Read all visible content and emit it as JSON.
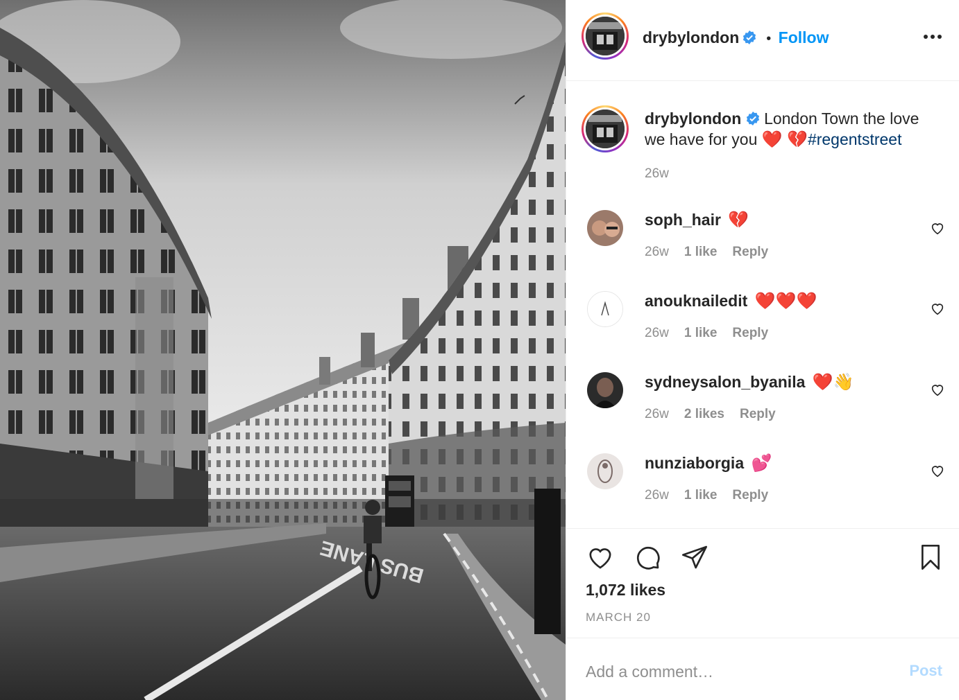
{
  "post": {
    "username": "drybylondon",
    "follow_label": "Follow",
    "separator": "•",
    "photo_subject": "black-and-white street photo of curved Regent Street buildings with a cyclist",
    "road_marking": "BUS LANE"
  },
  "caption": {
    "username": "drybylondon",
    "text_before": "London Town the love we have for you",
    "emoji_1": "❤️",
    "emoji_2": "💔",
    "hashtag": "#regentstreet",
    "time": "26w"
  },
  "comments": [
    {
      "username": "soph_hair",
      "text": "💔",
      "time": "26w",
      "likes": "1 like",
      "reply": "Reply"
    },
    {
      "username": "anouknailedit",
      "text": "❤️❤️❤️",
      "time": "26w",
      "likes": "1 like",
      "reply": "Reply"
    },
    {
      "username": "sydneysalon_byanila",
      "text": "❤️👋",
      "time": "26w",
      "likes": "2 likes",
      "reply": "Reply"
    },
    {
      "username": "nunziaborgia",
      "text": "💕",
      "time": "26w",
      "likes": "1 like",
      "reply": "Reply"
    }
  ],
  "actions": {
    "likes": "1,072 likes",
    "date": "MARCH 20"
  },
  "comment_box": {
    "placeholder": "Add a comment…",
    "post_label": "Post"
  },
  "colors": {
    "accent": "#0095f6",
    "hashtag": "#00376b",
    "muted": "#8e8e8e",
    "post_disabled": "#b3dbff"
  }
}
